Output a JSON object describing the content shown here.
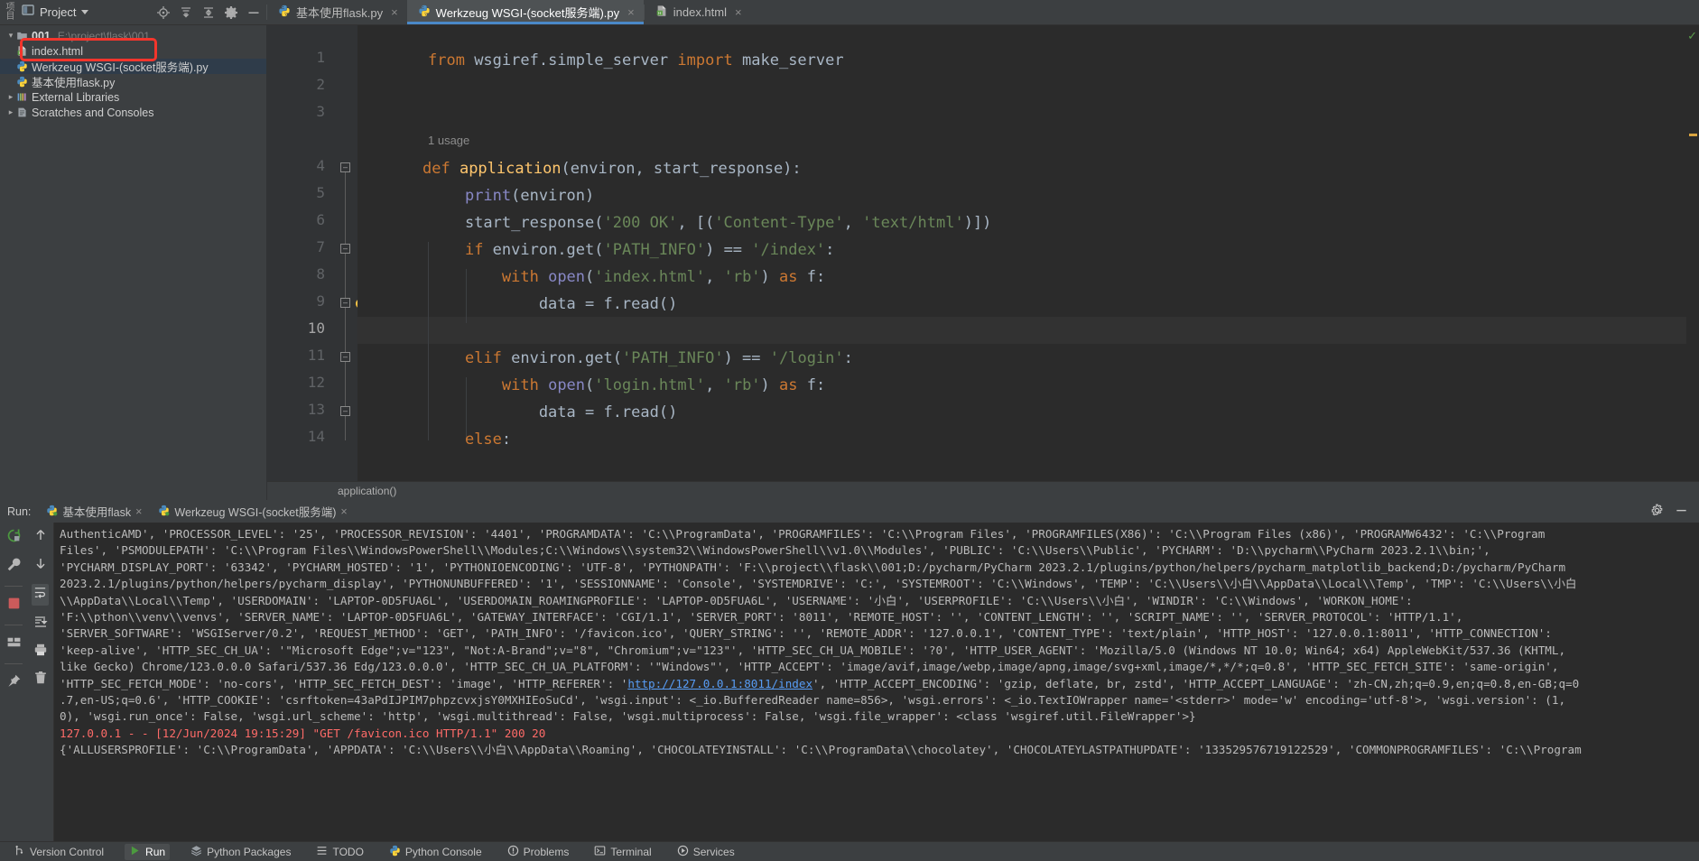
{
  "window": {
    "vertical_rail_label": "项目"
  },
  "project_panel": {
    "title": "Project",
    "dropdown_icon": "chevron-down-icon",
    "toolbar_icons": [
      "locate-icon",
      "collapse-all-icon",
      "expand-all-icon",
      "settings-gear-icon",
      "hide-icon"
    ],
    "tree": [
      {
        "label": "001",
        "detail": "E:\\project\\flask\\001",
        "indent": 0,
        "expanded": true,
        "icon": "folder-icon",
        "selected": false,
        "highlighted": false
      },
      {
        "label": "index.html",
        "detail": "",
        "indent": 1,
        "expanded": null,
        "icon": "html-file-icon",
        "selected": false,
        "highlighted": true
      },
      {
        "label": "Werkzeug WSGI-(socket服务端).py",
        "detail": "",
        "indent": 1,
        "expanded": null,
        "icon": "python-file-icon",
        "selected": true,
        "highlighted": false
      },
      {
        "label": "基本使用flask.py",
        "detail": "",
        "indent": 1,
        "expanded": null,
        "icon": "python-file-icon",
        "selected": false,
        "highlighted": false
      },
      {
        "label": "External Libraries",
        "detail": "",
        "indent": 0,
        "expanded": false,
        "icon": "library-icon",
        "selected": false,
        "highlighted": false
      },
      {
        "label": "Scratches and Consoles",
        "detail": "",
        "indent": 0,
        "expanded": false,
        "icon": "scratches-icon",
        "selected": false,
        "highlighted": false
      }
    ]
  },
  "editor_tabs": [
    {
      "label": "基本使用flask.py",
      "icon": "python-file-icon",
      "active": false,
      "close": "×"
    },
    {
      "label": "Werkzeug WSGI-(socket服务端).py",
      "icon": "python-file-icon",
      "active": true,
      "close": "×"
    },
    {
      "label": "index.html",
      "icon": "html-file-icon",
      "active": false,
      "close": "×"
    }
  ],
  "editor": {
    "inlay_hint": "1 usage",
    "breadcrumb": "application()",
    "current_line": 10,
    "lines": [
      {
        "n": 1,
        "tokens": [
          {
            "t": "from ",
            "c": "kw"
          },
          {
            "t": "wsgiref.simple_server ",
            "c": "pl"
          },
          {
            "t": "import ",
            "c": "kw"
          },
          {
            "t": "make_server",
            "c": "pl"
          }
        ]
      },
      {
        "n": 2,
        "tokens": []
      },
      {
        "n": 3,
        "tokens": []
      },
      {
        "n": 4,
        "tokens": [
          {
            "t": "def ",
            "c": "kw"
          },
          {
            "t": "application",
            "c": "fn"
          },
          {
            "t": "(environ, start_response):",
            "c": "pl"
          }
        ]
      },
      {
        "n": 5,
        "tokens": [
          {
            "t": "    ",
            "c": "pl"
          },
          {
            "t": "print",
            "c": "bi"
          },
          {
            "t": "(environ)",
            "c": "pl"
          }
        ]
      },
      {
        "n": 6,
        "tokens": [
          {
            "t": "    start_response(",
            "c": "pl"
          },
          {
            "t": "'200 OK'",
            "c": "str"
          },
          {
            "t": ", [(",
            "c": "pl"
          },
          {
            "t": "'Content-Type'",
            "c": "str"
          },
          {
            "t": ", ",
            "c": "pl"
          },
          {
            "t": "'text/html'",
            "c": "str"
          },
          {
            "t": ")])",
            "c": "pl"
          }
        ]
      },
      {
        "n": 7,
        "tokens": [
          {
            "t": "    ",
            "c": "pl"
          },
          {
            "t": "if ",
            "c": "kw"
          },
          {
            "t": "environ.get(",
            "c": "pl"
          },
          {
            "t": "'PATH_INFO'",
            "c": "str"
          },
          {
            "t": ") == ",
            "c": "pl"
          },
          {
            "t": "'/index'",
            "c": "str"
          },
          {
            "t": ":",
            "c": "pl"
          }
        ]
      },
      {
        "n": 8,
        "tokens": [
          {
            "t": "        ",
            "c": "pl"
          },
          {
            "t": "with ",
            "c": "kw"
          },
          {
            "t": "open",
            "c": "bi"
          },
          {
            "t": "(",
            "c": "pl"
          },
          {
            "t": "'index.html'",
            "c": "str"
          },
          {
            "t": ", ",
            "c": "pl"
          },
          {
            "t": "'rb'",
            "c": "str"
          },
          {
            "t": ") ",
            "c": "pl"
          },
          {
            "t": "as ",
            "c": "kw"
          },
          {
            "t": "f:",
            "c": "pl"
          }
        ]
      },
      {
        "n": 9,
        "tokens": [
          {
            "t": "            data = f.read()",
            "c": "pl"
          }
        ]
      },
      {
        "n": 10,
        "tokens": []
      },
      {
        "n": 11,
        "tokens": [
          {
            "t": "    ",
            "c": "pl"
          },
          {
            "t": "elif ",
            "c": "kw"
          },
          {
            "t": "environ.get(",
            "c": "pl"
          },
          {
            "t": "'PATH_INFO'",
            "c": "str"
          },
          {
            "t": ") == ",
            "c": "pl"
          },
          {
            "t": "'/login'",
            "c": "str"
          },
          {
            "t": ":",
            "c": "pl"
          }
        ]
      },
      {
        "n": 12,
        "tokens": [
          {
            "t": "        ",
            "c": "pl"
          },
          {
            "t": "with ",
            "c": "kw"
          },
          {
            "t": "open",
            "c": "bi"
          },
          {
            "t": "(",
            "c": "pl"
          },
          {
            "t": "'login.html'",
            "c": "str"
          },
          {
            "t": ", ",
            "c": "pl"
          },
          {
            "t": "'rb'",
            "c": "str"
          },
          {
            "t": ") ",
            "c": "pl"
          },
          {
            "t": "as ",
            "c": "kw"
          },
          {
            "t": "f:",
            "c": "pl"
          }
        ]
      },
      {
        "n": 13,
        "tokens": [
          {
            "t": "            data = f.read()",
            "c": "pl"
          }
        ]
      },
      {
        "n": 14,
        "tokens": [
          {
            "t": "    ",
            "c": "pl"
          },
          {
            "t": "else",
            "c": "kw"
          },
          {
            "t": ":",
            "c": "pl"
          }
        ]
      }
    ]
  },
  "run_panel": {
    "label": "Run:",
    "tabs": [
      {
        "label": "基本使用flask",
        "icon": "python-run-icon",
        "active": false,
        "close": "×"
      },
      {
        "label": "Werkzeug WSGI-(socket服务端)",
        "icon": "python-run-icon",
        "active": true,
        "close": "×"
      }
    ],
    "header_icons": [
      "settings-gear-icon",
      "minimize-icon"
    ],
    "left_toolbar_icons": [
      "rerun-icon",
      "wrench-icon",
      "stop-icon",
      "layout-icon",
      "pin-icon"
    ],
    "right_toolbar_icons": [
      "up-arrow-icon",
      "down-arrow-icon",
      "soft-wrap-icon",
      "scroll-to-end-icon",
      "print-icon",
      "trash-icon"
    ],
    "console_lines": [
      {
        "type": "text",
        "text": "AuthenticAMD', 'PROCESSOR_LEVEL': '25', 'PROCESSOR_REVISION': '4401', 'PROGRAMDATA': 'C:\\\\ProgramData', 'PROGRAMFILES': 'C:\\\\Program Files', 'PROGRAMFILES(X86)': 'C:\\\\Program Files (x86)', 'PROGRAMW6432': 'C:\\\\Program"
      },
      {
        "type": "text",
        "text": "Files', 'PSMODULEPATH': 'C:\\\\Program Files\\\\WindowsPowerShell\\\\Modules;C:\\\\Windows\\\\system32\\\\WindowsPowerShell\\\\v1.0\\\\Modules', 'PUBLIC': 'C:\\\\Users\\\\Public', 'PYCHARM': 'D:\\\\pycharm\\\\PyCharm 2023.2.1\\\\bin;',"
      },
      {
        "type": "text",
        "text": "'PYCHARM_DISPLAY_PORT': '63342', 'PYCHARM_HOSTED': '1', 'PYTHONIOENCODING': 'UTF-8', 'PYTHONPATH': 'F:\\\\project\\\\flask\\\\001;D:/pycharm/PyCharm 2023.2.1/plugins/python/helpers/pycharm_matplotlib_backend;D:/pycharm/PyCharm"
      },
      {
        "type": "text",
        "text": "2023.2.1/plugins/python/helpers/pycharm_display', 'PYTHONUNBUFFERED': '1', 'SESSIONNAME': 'Console', 'SYSTEMDRIVE': 'C:', 'SYSTEMROOT': 'C:\\\\Windows', 'TEMP': 'C:\\\\Users\\\\小白\\\\AppData\\\\Local\\\\Temp', 'TMP': 'C:\\\\Users\\\\小白"
      },
      {
        "type": "text",
        "text": "\\\\AppData\\\\Local\\\\Temp', 'USERDOMAIN': 'LAPTOP-0D5FUA6L', 'USERDOMAIN_ROAMINGPROFILE': 'LAPTOP-0D5FUA6L', 'USERNAME': '小白', 'USERPROFILE': 'C:\\\\Users\\\\小白', 'WINDIR': 'C:\\\\Windows', 'WORKON_HOME':"
      },
      {
        "type": "text",
        "text": "'F:\\\\pthon\\\\venv\\\\venvs', 'SERVER_NAME': 'LAPTOP-0D5FUA6L', 'GATEWAY_INTERFACE': 'CGI/1.1', 'SERVER_PORT': '8011', 'REMOTE_HOST': '', 'CONTENT_LENGTH': '', 'SCRIPT_NAME': '', 'SERVER_PROTOCOL': 'HTTP/1.1',"
      },
      {
        "type": "text",
        "text": "'SERVER_SOFTWARE': 'WSGIServer/0.2', 'REQUEST_METHOD': 'GET', 'PATH_INFO': '/favicon.ico', 'QUERY_STRING': '', 'REMOTE_ADDR': '127.0.0.1', 'CONTENT_TYPE': 'text/plain', 'HTTP_HOST': '127.0.0.1:8011', 'HTTP_CONNECTION':"
      },
      {
        "type": "text",
        "text": "'keep-alive', 'HTTP_SEC_CH_UA': '\"Microsoft Edge\";v=\"123\", \"Not:A-Brand\";v=\"8\", \"Chromium\";v=\"123\"', 'HTTP_SEC_CH_UA_MOBILE': '?0', 'HTTP_USER_AGENT': 'Mozilla/5.0 (Windows NT 10.0; Win64; x64) AppleWebKit/537.36 (KHTML,"
      },
      {
        "type": "text",
        "text": "like Gecko) Chrome/123.0.0.0 Safari/537.36 Edg/123.0.0.0', 'HTTP_SEC_CH_UA_PLATFORM': '\"Windows\"', 'HTTP_ACCEPT': 'image/avif,image/webp,image/apng,image/svg+xml,image/*,*/*;q=0.8', 'HTTP_SEC_FETCH_SITE': 'same-origin',"
      },
      {
        "type": "link_line",
        "pre": "'HTTP_SEC_FETCH_MODE': 'no-cors', 'HTTP_SEC_FETCH_DEST': 'image', 'HTTP_REFERER': '",
        "link": "http://127.0.0.1:8011/index",
        "post": "', 'HTTP_ACCEPT_ENCODING': 'gzip, deflate, br, zstd', 'HTTP_ACCEPT_LANGUAGE': 'zh-CN,zh;q=0.9,en;q=0.8,en-GB;q=0"
      },
      {
        "type": "text",
        "text": ".7,en-US;q=0.6', 'HTTP_COOKIE': 'csrftoken=43aPdIJPIM7phpzcvxjsY0MXHIEoSuCd', 'wsgi.input': <_io.BufferedReader name=856>, 'wsgi.errors': <_io.TextIOWrapper name='<stderr>' mode='w' encoding='utf-8'>, 'wsgi.version': (1,"
      },
      {
        "type": "text",
        "text": "0), 'wsgi.run_once': False, 'wsgi.url_scheme': 'http', 'wsgi.multithread': False, 'wsgi.multiprocess': False, 'wsgi.file_wrapper': <class 'wsgiref.util.FileWrapper'>}"
      },
      {
        "type": "error",
        "text": "127.0.0.1 - - [12/Jun/2024 19:15:29] \"GET /favicon.ico HTTP/1.1\" 200 20"
      },
      {
        "type": "text",
        "text": "{'ALLUSERSPROFILE': 'C:\\\\ProgramData', 'APPDATA': 'C:\\\\Users\\\\小白\\\\AppData\\\\Roaming', 'CHOCOLATEYINSTALL': 'C:\\\\ProgramData\\\\chocolatey', 'CHOCOLATEYLASTPATHUPDATE': '133529576719122529', 'COMMONPROGRAMFILES': 'C:\\\\Program"
      }
    ]
  },
  "status_bar": {
    "items": [
      {
        "label": "Version Control",
        "icon": "branch-icon",
        "active": false
      },
      {
        "label": "Run",
        "icon": "run-play-icon",
        "active": true
      },
      {
        "label": "Python Packages",
        "icon": "packages-icon",
        "active": false
      },
      {
        "label": "TODO",
        "icon": "todo-icon",
        "active": false
      },
      {
        "label": "Python Console",
        "icon": "python-console-icon",
        "active": false
      },
      {
        "label": "Problems",
        "icon": "problems-icon",
        "active": false
      },
      {
        "label": "Terminal",
        "icon": "terminal-icon",
        "active": false
      },
      {
        "label": "Services",
        "icon": "services-icon",
        "active": false
      }
    ]
  },
  "colors": {
    "accent_blue": "#4a88c7",
    "annotation_red": "#f4352c",
    "error_red": "#ff6b68",
    "link_blue": "#589df6",
    "editor_bg": "#2b2b2b",
    "panel_bg": "#3c3f41"
  }
}
